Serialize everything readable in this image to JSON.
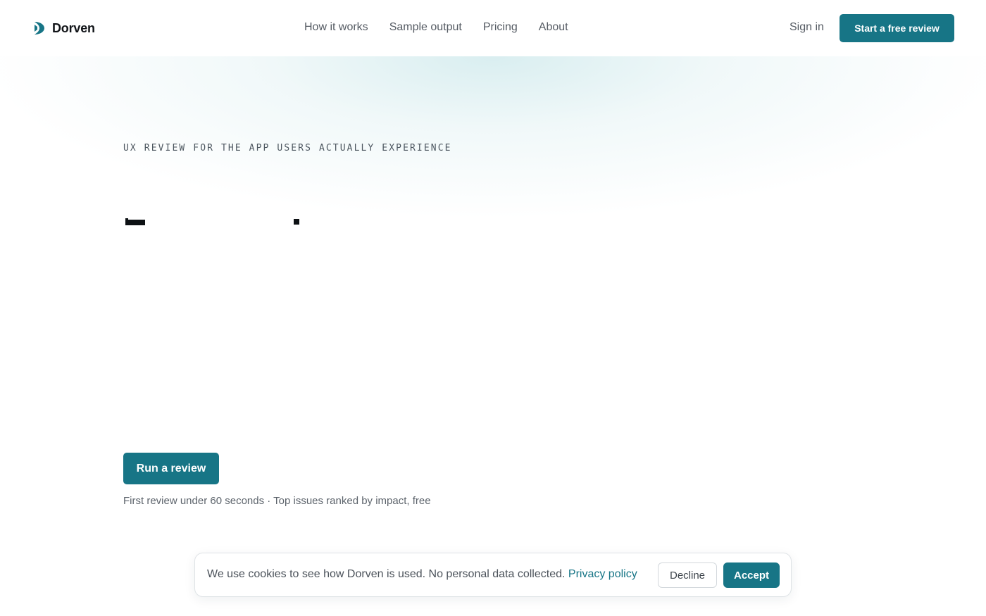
{
  "brand": {
    "name": "Dorven",
    "logo_icon": "dorven-logo-icon",
    "accent_color": "#177586"
  },
  "nav": {
    "items": [
      {
        "label": "How it works"
      },
      {
        "label": "Sample output"
      },
      {
        "label": "Pricing"
      },
      {
        "label": "About"
      }
    ]
  },
  "header": {
    "sign_in_label": "Sign in",
    "cta_label": "Start a free review"
  },
  "hero": {
    "eyebrow": "UX REVIEW FOR THE APP USERS ACTUALLY EXPERIENCE",
    "primary_button": "Run a review",
    "subtext": "First review under 60 seconds · Top issues ranked by impact, free"
  },
  "cookie_banner": {
    "text": "We use cookies to see how Dorven is used. No personal data collected.",
    "link_label": "Privacy policy",
    "decline_label": "Decline",
    "accept_label": "Accept"
  }
}
